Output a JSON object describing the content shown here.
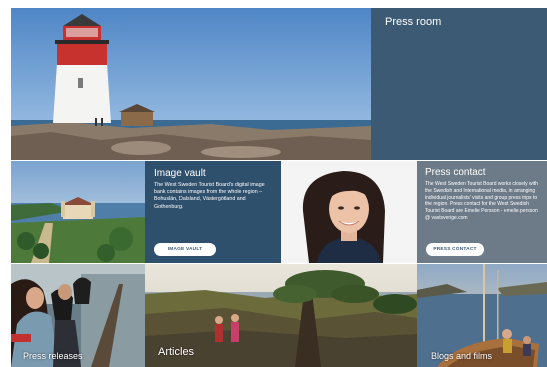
{
  "press_room": {
    "title": "Press room"
  },
  "image_vault": {
    "title": "Image vault",
    "description": "The West Sweden Tourist Board's digital image bank contains images from the whole region – Bohuslän, Dalsland, Västergötland and Gothenburg.",
    "button_label": "IMAGE VAULT"
  },
  "press_contact": {
    "title": "Press contact",
    "description": "The West Sweden Tourist Board works closely with the Swedish and International media, in arranging individual journalists' visits and group press trips to the region. Press contact for the West Swedish Tourist Board are Emelie Persson - emelie.persson @ vastsverige.com",
    "button_label": "PRESS CONTACT"
  },
  "tiles": {
    "press_releases": "Press releases",
    "articles": "Articles",
    "blogs": "Blogs and films"
  },
  "colors": {
    "press_room_bg": "#3d5a75",
    "image_vault_bg": "#2f506d",
    "press_contact_bg": "#6d7a87"
  }
}
